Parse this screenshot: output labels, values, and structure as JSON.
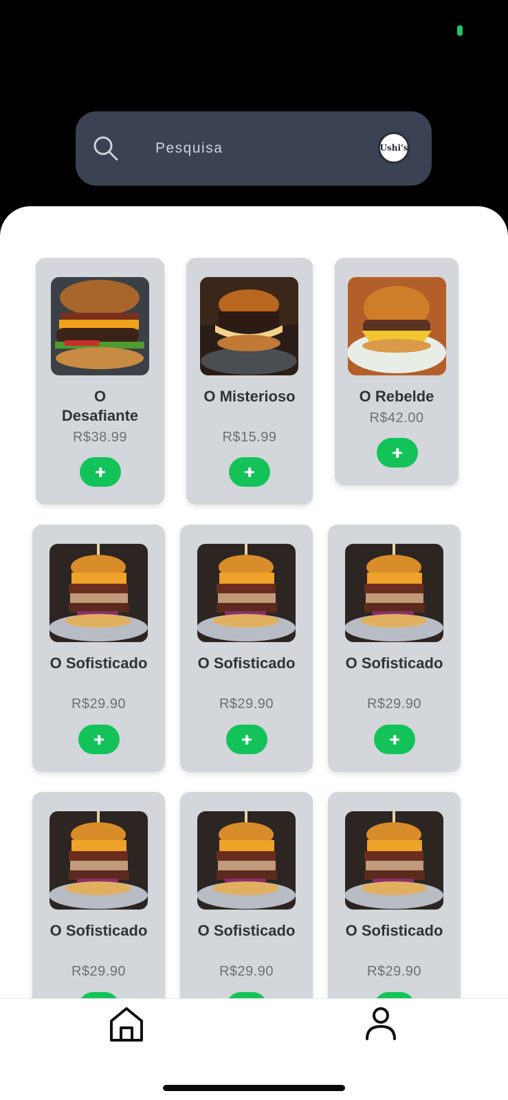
{
  "search": {
    "placeholder": "Pesquisa"
  },
  "brand": {
    "logo_text": "Ushi's"
  },
  "products": [
    {
      "name": "O Desafiante",
      "price": "R$38.99",
      "image": "burger-bacon-cheddar"
    },
    {
      "name": "O Misterioso",
      "price": "R$15.99",
      "image": "burger-cheese-melt"
    },
    {
      "name": "O Rebelde",
      "price": "R$42.00",
      "image": "burger-sesame-bun"
    },
    {
      "name": "O Sofisticado",
      "price": "R$29.90",
      "image": "burger-tower"
    },
    {
      "name": "O Sofisticado",
      "price": "R$29.90",
      "image": "burger-tower"
    },
    {
      "name": "O Sofisticado",
      "price": "R$29.90",
      "image": "burger-tower"
    },
    {
      "name": "O Sofisticado",
      "price": "R$29.90",
      "image": "burger-tower"
    },
    {
      "name": "O Sofisticado",
      "price": "R$29.90",
      "image": "burger-tower"
    },
    {
      "name": "O Sofisticado",
      "price": "R$29.90",
      "image": "burger-tower"
    }
  ],
  "nav": {
    "items": [
      {
        "icon": "home-icon"
      },
      {
        "icon": "profile-icon"
      }
    ]
  },
  "colors": {
    "accent": "#13c35a",
    "search_bg": "#3a4254",
    "card_bg": "#d3d6db"
  }
}
